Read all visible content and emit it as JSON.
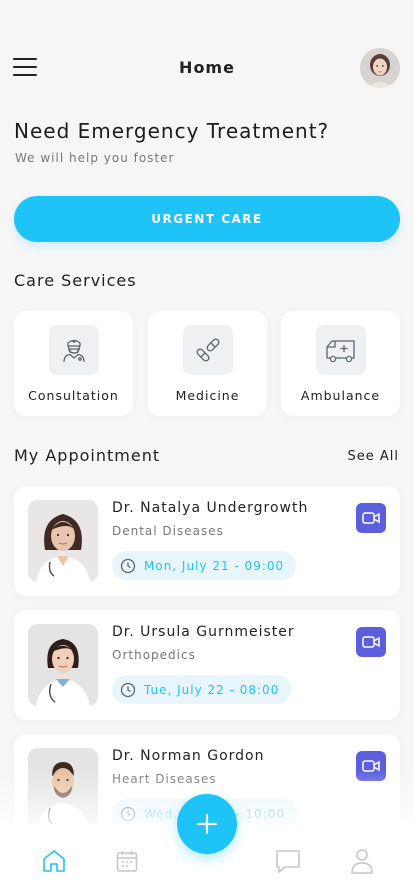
{
  "header": {
    "title": "Home"
  },
  "hero": {
    "title": "Need Emergency Treatment?",
    "subtitle": "We will help you foster",
    "button_label": "URGENT CARE"
  },
  "services": {
    "title": "Care Services",
    "items": [
      {
        "label": "Consultation",
        "icon": "doctor-icon"
      },
      {
        "label": "Medicine",
        "icon": "pills-icon"
      },
      {
        "label": "Ambulance",
        "icon": "ambulance-icon"
      }
    ]
  },
  "appointments": {
    "title": "My Appointment",
    "see_all": "See All",
    "items": [
      {
        "doctor": "Dr. Natalya Undergrowth",
        "specialty": "Dental Diseases",
        "date": "Mon, July 21 - 09:00"
      },
      {
        "doctor": "Dr. Ursula Gurnmeister",
        "specialty": "Orthopedics",
        "date": "Tue, July 22 - 08:00"
      },
      {
        "doctor": "Dr. Norman Gordon",
        "specialty": "Heart Diseases",
        "date": "Wed, July 23 - 10:00"
      }
    ]
  },
  "tabbar": {
    "items": [
      "home-icon",
      "calendar-icon",
      "chat-icon",
      "profile-icon"
    ],
    "active": "home-icon"
  },
  "colors": {
    "accent": "#1ec3f7",
    "video": "#5b5fde",
    "background": "#f6f6f7"
  }
}
